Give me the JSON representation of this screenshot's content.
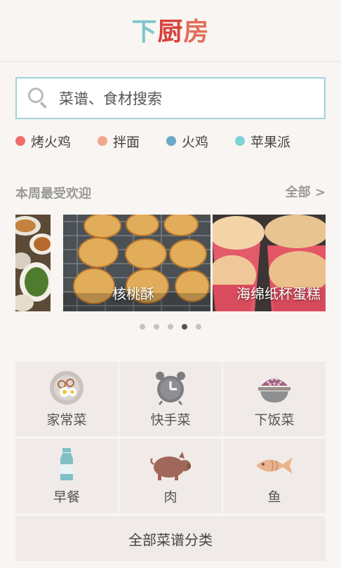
{
  "header": {
    "logo_part1": "下",
    "logo_part2": "厨",
    "logo_part3": "房"
  },
  "search": {
    "placeholder": "菜谱、食材搜索"
  },
  "hot_tags": [
    {
      "label": "烤火鸡",
      "color": "#ef6f6c"
    },
    {
      "label": "拌面",
      "color": "#f2a68f"
    },
    {
      "label": "火鸡",
      "color": "#6aa8c4"
    },
    {
      "label": "苹果派",
      "color": "#7fd3d8"
    }
  ],
  "popular": {
    "title": "本周最受欢迎",
    "all_label": "全部 >",
    "slides": [
      {
        "label": ""
      },
      {
        "label": "核桃酥"
      },
      {
        "label": "海绵纸杯蛋糕"
      }
    ],
    "page_count": 5,
    "active_page": 4
  },
  "categories": [
    {
      "label": "家常菜",
      "icon": "plate-icon"
    },
    {
      "label": "快手菜",
      "icon": "alarm-clock-icon"
    },
    {
      "label": "下饭菜",
      "icon": "rice-bowl-icon"
    },
    {
      "label": "早餐",
      "icon": "milk-bottle-icon"
    },
    {
      "label": "肉",
      "icon": "pig-icon"
    },
    {
      "label": "鱼",
      "icon": "fish-icon"
    }
  ],
  "all_categories_label": "全部菜谱分类"
}
